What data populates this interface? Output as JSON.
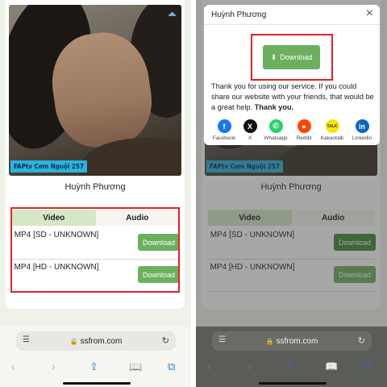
{
  "page": {
    "name": "Huỳnh Phương",
    "photo_tag": "FAPtv Cơm Nguội 257",
    "tabs": [
      "Video",
      "Audio"
    ],
    "rows": [
      {
        "format": "MP4 [SD - UNKNOWN]",
        "button": "Download"
      },
      {
        "format": "MP4 [HD - UNKNOWN]",
        "button": "Download"
      }
    ]
  },
  "browser": {
    "url": "ssfrom.com"
  },
  "modal": {
    "title": "Huỳnh Phương",
    "download_label": "Download",
    "message": "Thank you for using our service. If you could share our website with your friends, that would be a great help.",
    "message_bold": "Thank you.",
    "share": [
      {
        "label": "Facebook",
        "color": "#1877f2",
        "glyph": "f"
      },
      {
        "label": "X",
        "color": "#111111",
        "glyph": "X"
      },
      {
        "label": "Whatsapp",
        "color": "#25d366",
        "glyph": "W"
      },
      {
        "label": "Reddit",
        "color": "#ff4500",
        "glyph": "R"
      },
      {
        "label": "Kakaotalk",
        "color": "#f7e600",
        "glyph": "TALK"
      },
      {
        "label": "Linkedin",
        "color": "#0a66c2",
        "glyph": "in"
      }
    ]
  },
  "colors": {
    "accent_green": "#6daf5f",
    "highlight_red": "#e02424"
  }
}
